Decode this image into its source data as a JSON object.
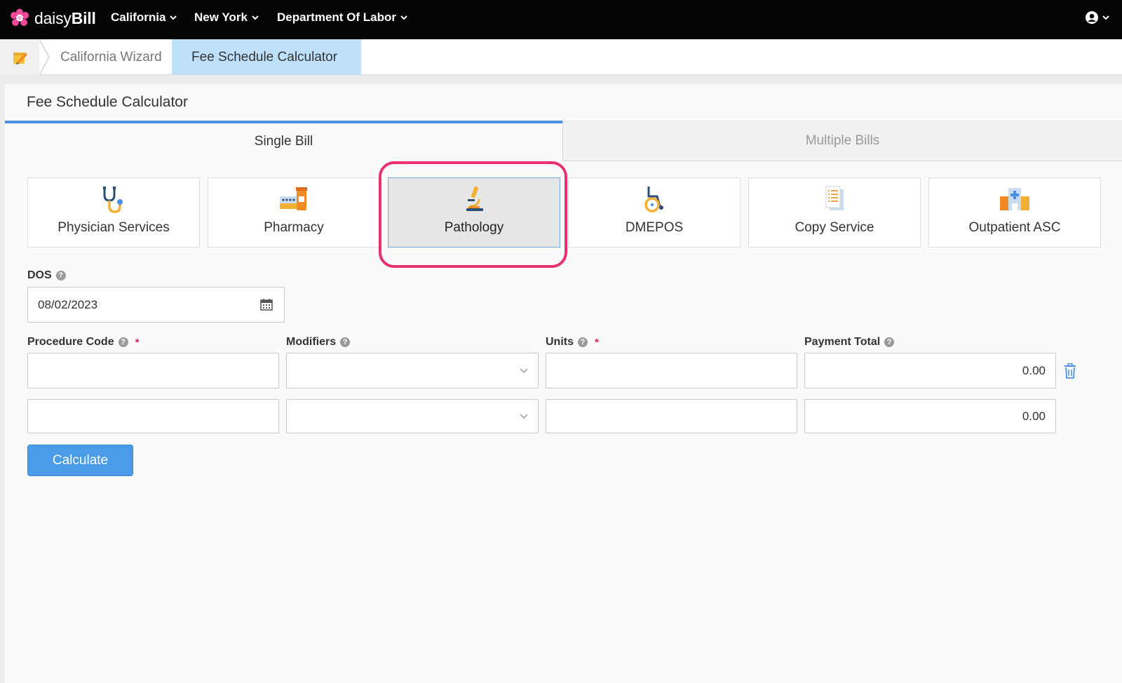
{
  "nav": {
    "brand_light": "daisy",
    "brand_bold": "Bill",
    "menus": [
      "California",
      "New York",
      "Department Of Labor"
    ]
  },
  "breadcrumb": {
    "items": [
      "California Wizard",
      "Fee Schedule Calculator"
    ]
  },
  "panel": {
    "title": "Fee Schedule Calculator",
    "tabs": [
      "Single Bill",
      "Multiple Bills"
    ],
    "active_tab": "Single Bill"
  },
  "services": {
    "items": [
      {
        "label": "Physician Services",
        "icon": "stethoscope-icon"
      },
      {
        "label": "Pharmacy",
        "icon": "pharmacy-icon"
      },
      {
        "label": "Pathology",
        "icon": "microscope-icon"
      },
      {
        "label": "DMEPOS",
        "icon": "wheelchair-icon"
      },
      {
        "label": "Copy Service",
        "icon": "document-copy-icon"
      },
      {
        "label": "Outpatient ASC",
        "icon": "hospital-icon"
      }
    ],
    "selected": "Pathology"
  },
  "form": {
    "dos_label": "DOS",
    "dos_value": "08/02/2023",
    "procedure_code_label": "Procedure Code",
    "modifiers_label": "Modifiers",
    "units_label": "Units",
    "payment_total_label": "Payment Total",
    "required_mark": "*",
    "help_glyph": "?",
    "rows": [
      {
        "procedure_code": "",
        "modifiers": "",
        "units": "",
        "payment_total": "0.00"
      },
      {
        "procedure_code": "",
        "modifiers": "",
        "units": "",
        "payment_total": "0.00"
      }
    ],
    "calculate_label": "Calculate"
  },
  "colors": {
    "nav_bg": "#050505",
    "accent": "#4a90e2",
    "highlight": "#e8326f",
    "breadcrumb_active": "#bfe0fb"
  }
}
